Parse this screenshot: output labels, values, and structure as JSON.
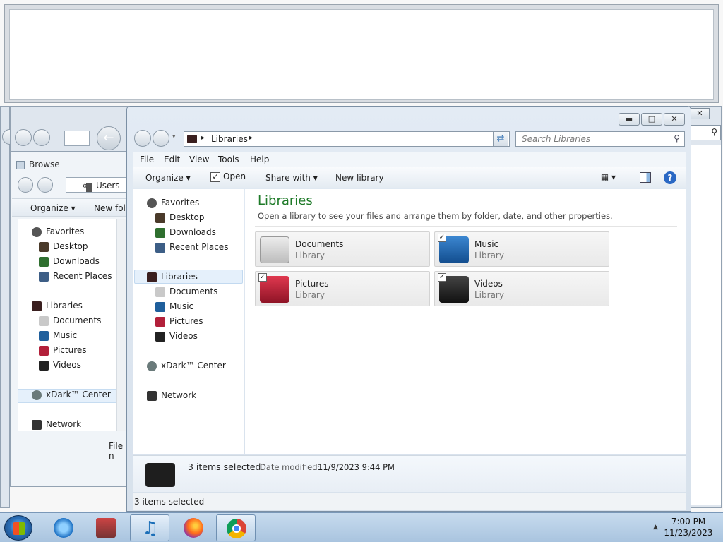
{
  "back_left": {
    "title": "Browse",
    "address": "Users",
    "crumb_prefix": "«",
    "organize": "Organize",
    "new_folder": "New fold",
    "file_name_label": "File n",
    "favorites": "Favorites",
    "desktop": "Desktop",
    "downloads": "Downloads",
    "recent": "Recent Places",
    "libraries": "Libraries",
    "documents": "Documents",
    "music": "Music",
    "pictures": "Pictures",
    "videos": "Videos",
    "xdark": "xDark™ Center",
    "network": "Network"
  },
  "explorer": {
    "address": {
      "crumb": "Libraries"
    },
    "search_placeholder": "Search Libraries",
    "menu": {
      "file": "File",
      "edit": "Edit",
      "view": "View",
      "tools": "Tools",
      "help": "Help"
    },
    "commands": {
      "organize": "Organize",
      "open": "Open",
      "share": "Share with",
      "new_library": "New library"
    },
    "nav": {
      "favorites": "Favorites",
      "desktop": "Desktop",
      "downloads": "Downloads",
      "recent": "Recent Places",
      "libraries": "Libraries",
      "documents": "Documents",
      "music": "Music",
      "pictures": "Pictures",
      "videos": "Videos",
      "xdark": "xDark™ Center",
      "network": "Network"
    },
    "content": {
      "title": "Libraries",
      "subtitle": "Open a library to see your files and arrange them by folder, date, and other properties.",
      "libraries": [
        {
          "name": "Documents",
          "kind": "Library",
          "checked": false
        },
        {
          "name": "Music",
          "kind": "Library",
          "checked": true
        },
        {
          "name": "Pictures",
          "kind": "Library",
          "checked": true
        },
        {
          "name": "Videos",
          "kind": "Library",
          "checked": true
        }
      ]
    },
    "details": {
      "count": "3 items selected",
      "modified_label": "Date modified:",
      "modified_value": "11/9/2023 9:44 PM"
    },
    "status": "3 items selected"
  },
  "taskbar": {
    "time": "7:00 PM",
    "date": "11/23/2023"
  },
  "icons": {
    "favorites": "star-icon",
    "desktop": "desktop-icon",
    "downloads": "downloads-icon",
    "recent": "recent-places-icon",
    "libraries": "library-icon",
    "documents": "documents-icon",
    "music": "music-icon",
    "pictures": "pictures-icon",
    "videos": "videos-icon",
    "xdark": "xdark-icon",
    "network": "network-icon"
  },
  "colors": {
    "heading_green": "#1e7a28",
    "selection_blue": "#e5f0fb",
    "help_blue": "#2a68c4"
  }
}
